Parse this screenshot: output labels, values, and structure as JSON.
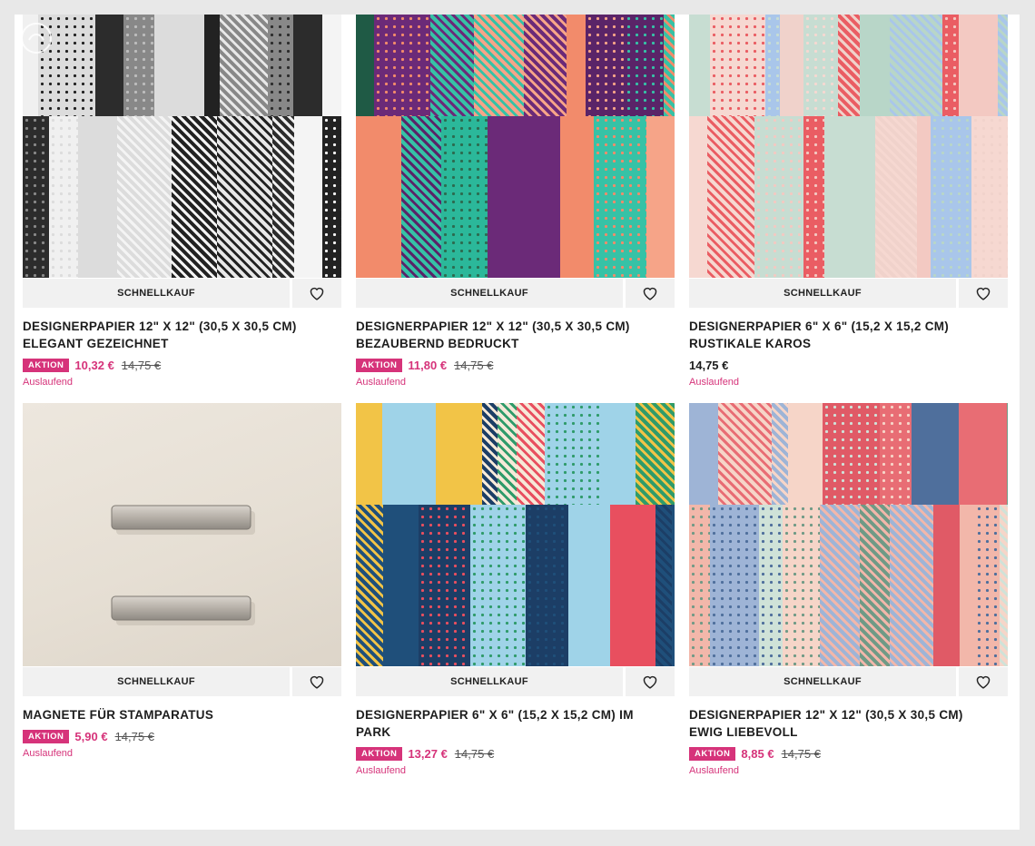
{
  "products": [
    {
      "title_line1": "DESIGNERPAPIER 12\" X 12\" (30,5 X 30,5 CM)",
      "title_line2": "ELEGANT GEZEICHNET",
      "badge": "AKTION",
      "price_sale": "10,32 €",
      "price_old": "14,75 €",
      "price_regular": "",
      "status": "Auslaufend",
      "quick_buy": "SCHNELLKAUF"
    },
    {
      "title_line1": "DESIGNERPAPIER 12\" X 12\" (30,5 X 30,5 CM)",
      "title_line2": "BEZAUBERND BEDRUCKT",
      "badge": "AKTION",
      "price_sale": "11,80 €",
      "price_old": "14,75 €",
      "price_regular": "",
      "status": "Auslaufend",
      "quick_buy": "SCHNELLKAUF"
    },
    {
      "title_line1": "DESIGNERPAPIER 6\" X 6\" (15,2 X 15,2 CM)",
      "title_line2": "RUSTIKALE KAROS",
      "badge": "",
      "price_sale": "",
      "price_old": "",
      "price_regular": "14,75 €",
      "status": "Auslaufend",
      "quick_buy": "SCHNELLKAUF"
    },
    {
      "title_line1": "MAGNETE FÜR STAMPARATUS",
      "title_line2": "",
      "badge": "AKTION",
      "price_sale": "5,90 €",
      "price_old": "14,75 €",
      "price_regular": "",
      "status": "Auslaufend",
      "quick_buy": "SCHNELLKAUF"
    },
    {
      "title_line1": "DESIGNERPAPIER 6\" X 6\" (15,2 X 15,2 CM) IM",
      "title_line2": "PARK",
      "badge": "AKTION",
      "price_sale": "13,27 €",
      "price_old": "14,75 €",
      "price_regular": "",
      "status": "Auslaufend",
      "quick_buy": "SCHNELLKAUF"
    },
    {
      "title_line1": "DESIGNERPAPIER 12\" X 12\" (30,5 X 30,5 CM)",
      "title_line2": "EWIG LIEBEVOLL",
      "badge": "AKTION",
      "price_sale": "8,85 €",
      "price_old": "14,75 €",
      "price_regular": "",
      "status": "Auslaufend",
      "quick_buy": "SCHNELLKAUF"
    }
  ],
  "palettes": {
    "elegant": [
      "#f4f4f4",
      "#3a3a3a",
      "#e8e8e8",
      "#bdbdbd",
      "#222222",
      "#f0f0f0",
      "#888888",
      "#2c2c2c",
      "#dcdcdc"
    ],
    "bezaubernd": [
      "#f28b6b",
      "#2bb89a",
      "#1f5a45",
      "#5a2468",
      "#f6a488",
      "#36c2a6",
      "#2c6b50",
      "#6b2a78"
    ],
    "rustikal": [
      "#f3c9c2",
      "#b8d6c8",
      "#f0d2cb",
      "#a9c6ea",
      "#ea5d63",
      "#f6d8d1",
      "#c7ddd2"
    ],
    "park": [
      "#1f4f7a",
      "#f2c447",
      "#2f9b6a",
      "#f6c0b0",
      "#e84f5f",
      "#9fd3e8",
      "#f6e9d8",
      "#1c3e66"
    ],
    "ewig": [
      "#f2b7aa",
      "#6f9a86",
      "#e86d74",
      "#4f6f9c",
      "#cfe2d8",
      "#f6d5c8",
      "#e05a66",
      "#9eb4d6"
    ]
  },
  "colors": {
    "accent": "#d6337a",
    "button_bg": "#f1f1f1"
  }
}
